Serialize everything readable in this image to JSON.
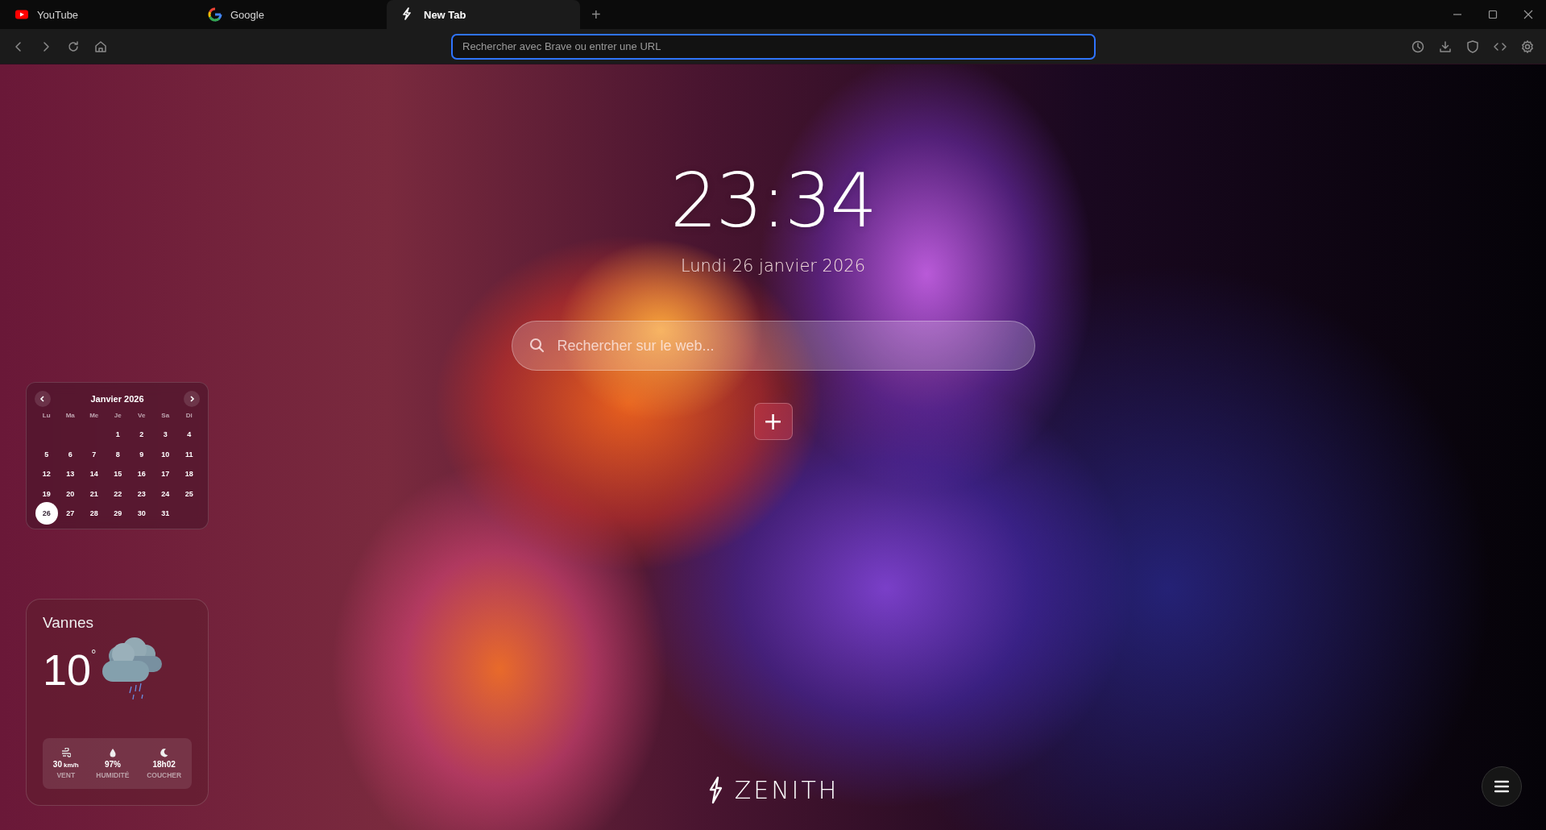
{
  "tabs": [
    {
      "title": "YouTube",
      "kind": "youtube",
      "selected": false
    },
    {
      "title": "Google",
      "kind": "google",
      "selected": false
    },
    {
      "title": "New Tab",
      "kind": "zenith",
      "selected": true
    }
  ],
  "new_tab_button": "+",
  "address_bar": {
    "placeholder": "Rechercher avec Brave ou entrer une URL"
  },
  "clock": {
    "time": "23:34",
    "date": "Lundi 26 janvier 2026"
  },
  "search": {
    "placeholder": "Rechercher sur le web..."
  },
  "add_shortcut_button": "+",
  "calendar": {
    "month": "Janvier 2026",
    "weekdays": [
      "Lu",
      "Ma",
      "Me",
      "Je",
      "Ve",
      "Sa",
      "Di"
    ],
    "weeks": [
      {
        "kind": "trailing",
        "days": [
          {
            "label": "1",
            "selected": false
          },
          {
            "label": "2",
            "selected": false
          },
          {
            "label": "3",
            "selected": false
          },
          {
            "label": "4",
            "selected": false
          }
        ]
      },
      {
        "kind": "leading",
        "days": [
          {
            "label": "5",
            "selected": false
          },
          {
            "label": "6",
            "selected": false
          },
          {
            "label": "7",
            "selected": false
          },
          {
            "label": "8",
            "selected": false
          },
          {
            "label": "9",
            "selected": false
          },
          {
            "label": "10",
            "selected": false
          },
          {
            "label": "11",
            "selected": false
          }
        ]
      },
      {
        "kind": "leading",
        "days": [
          {
            "label": "12",
            "selected": false
          },
          {
            "label": "13",
            "selected": false
          },
          {
            "label": "14",
            "selected": false
          },
          {
            "label": "15",
            "selected": false
          },
          {
            "label": "16",
            "selected": false
          },
          {
            "label": "17",
            "selected": false
          },
          {
            "label": "18",
            "selected": false
          }
        ]
      },
      {
        "kind": "leading",
        "days": [
          {
            "label": "19",
            "selected": false
          },
          {
            "label": "20",
            "selected": false
          },
          {
            "label": "21",
            "selected": false
          },
          {
            "label": "22",
            "selected": false
          },
          {
            "label": "23",
            "selected": false
          },
          {
            "label": "24",
            "selected": false
          },
          {
            "label": "25",
            "selected": false
          }
        ]
      },
      {
        "kind": "leading",
        "days": [
          {
            "label": "26",
            "selected": true
          },
          {
            "label": "27",
            "selected": false
          },
          {
            "label": "28",
            "selected": false
          },
          {
            "label": "29",
            "selected": false
          },
          {
            "label": "30",
            "selected": false
          },
          {
            "label": "31",
            "selected": false
          }
        ]
      }
    ]
  },
  "weather": {
    "city": "Vannes",
    "temperature": "10",
    "degree": "°",
    "kind": "rain",
    "stats": [
      {
        "kind": "wind",
        "value": "30",
        "unit": "km/h",
        "label": "VENT"
      },
      {
        "kind": "humidity",
        "value": "97%",
        "label": "HUMIDITÉ"
      },
      {
        "kind": "sunset",
        "value": "18h02",
        "label": "COUCHER"
      }
    ]
  },
  "brand": "ZENITH"
}
